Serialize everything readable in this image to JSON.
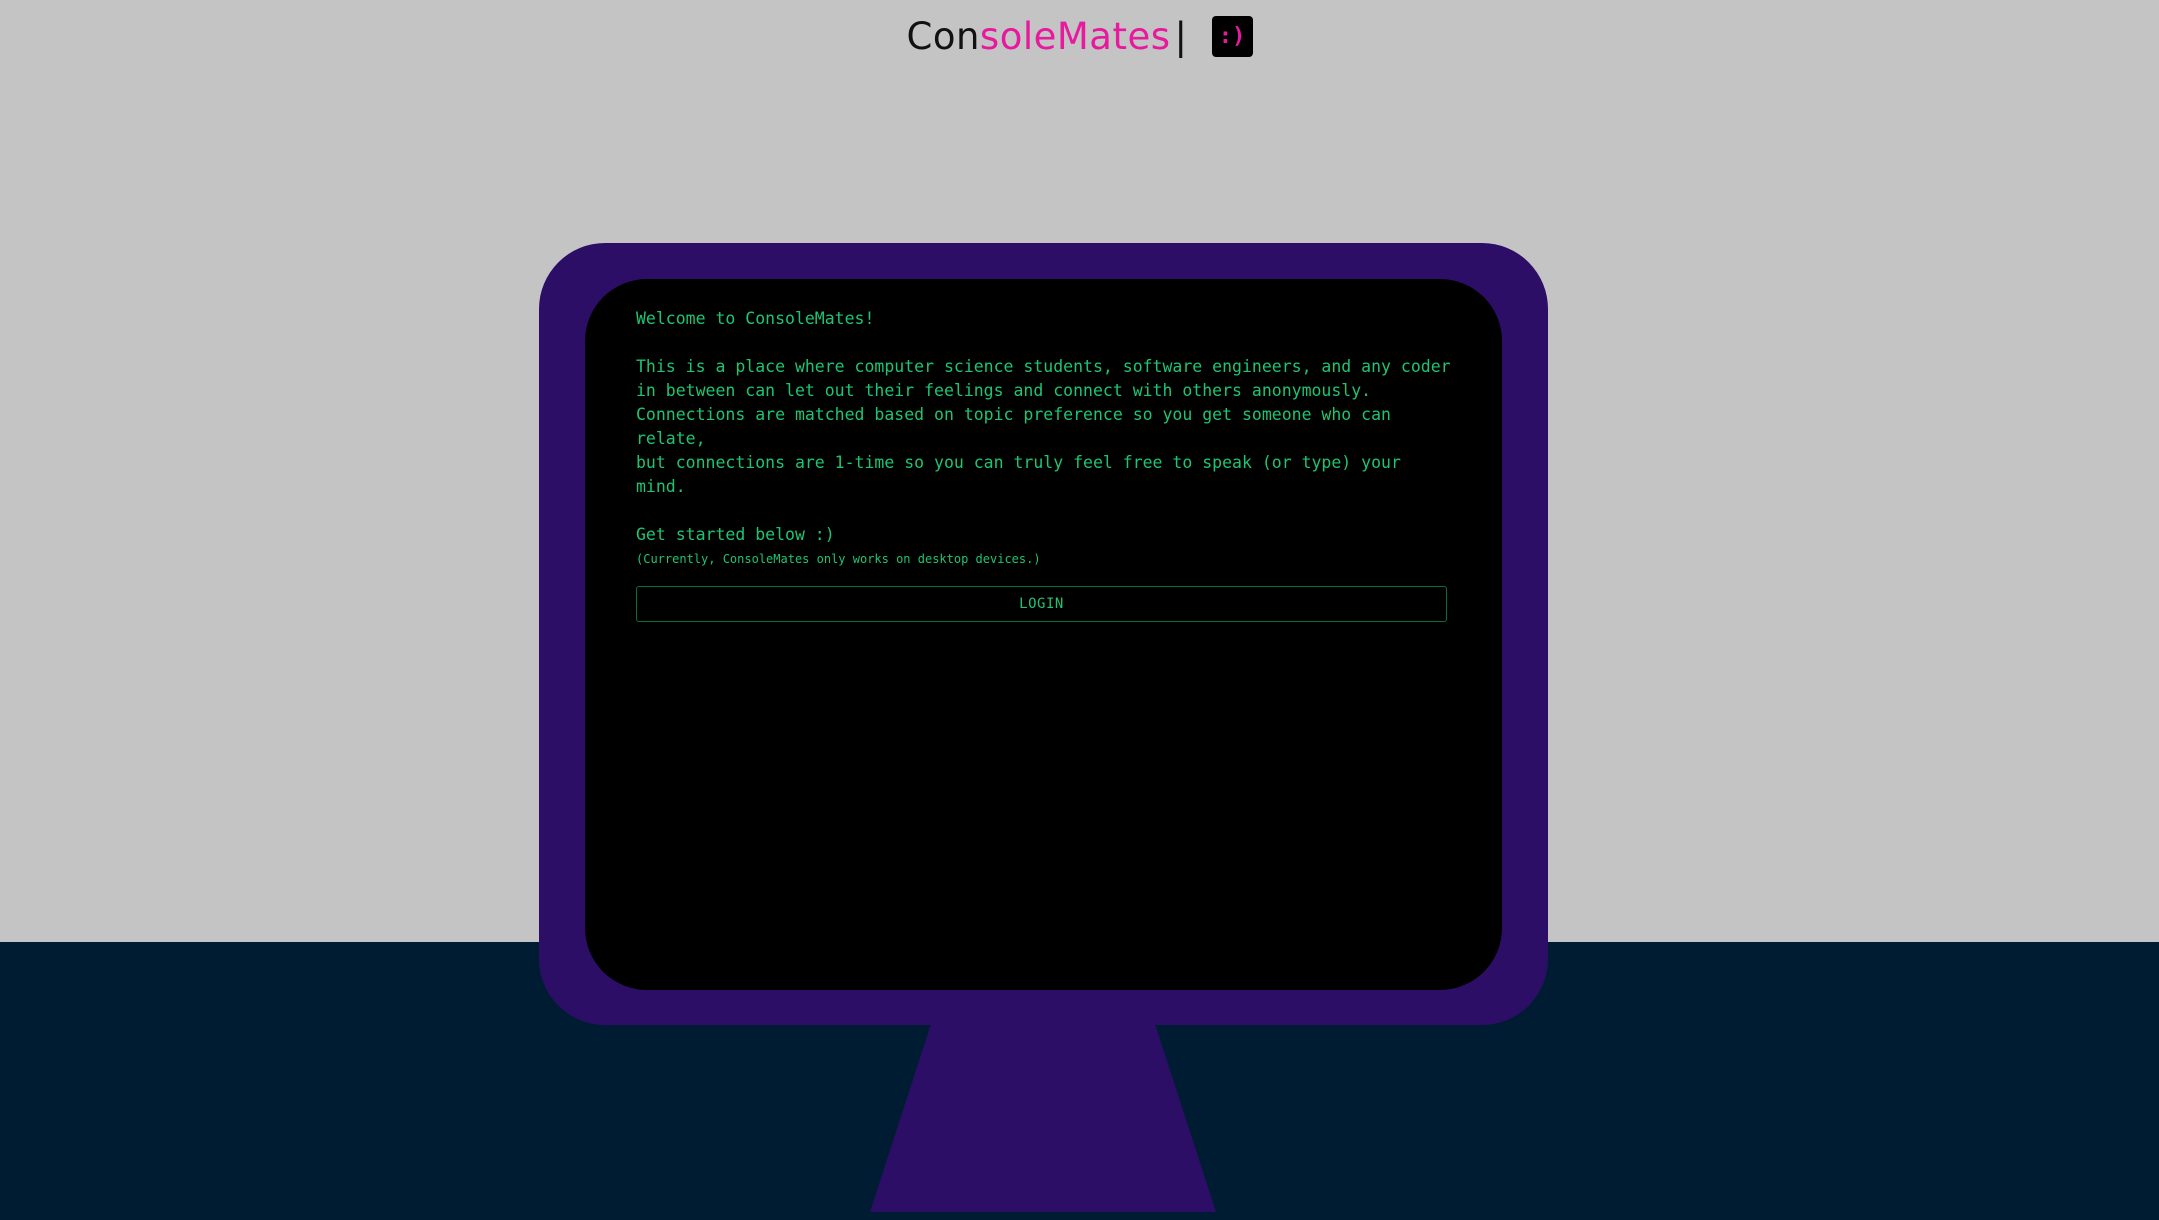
{
  "header": {
    "brand_part1": "Con",
    "brand_part2": "soleMates",
    "brand_cursor": "|",
    "smiley_badge": ":)"
  },
  "screen": {
    "welcome": "Welcome to ConsoleMates!",
    "description_lines": [
      "This is a place where computer science students, software engineers, and any coder",
      "in between can let out their feelings and connect with others anonymously.",
      "Connections are matched based on topic preference so you get someone who can relate,",
      "but connections are 1-time so you can truly feel free to speak (or type) your mind."
    ],
    "get_started": "Get started below :)",
    "note": "(Currently, ConsoleMates only works on desktop devices.)",
    "login_label": "LOGIN"
  },
  "colors": {
    "background": "#c4c4c4",
    "floor": "#001c33",
    "monitor_frame": "#2c0e67",
    "screen": "#000000",
    "terminal_text": "#1ec471",
    "brand_accent": "#e6199f"
  }
}
